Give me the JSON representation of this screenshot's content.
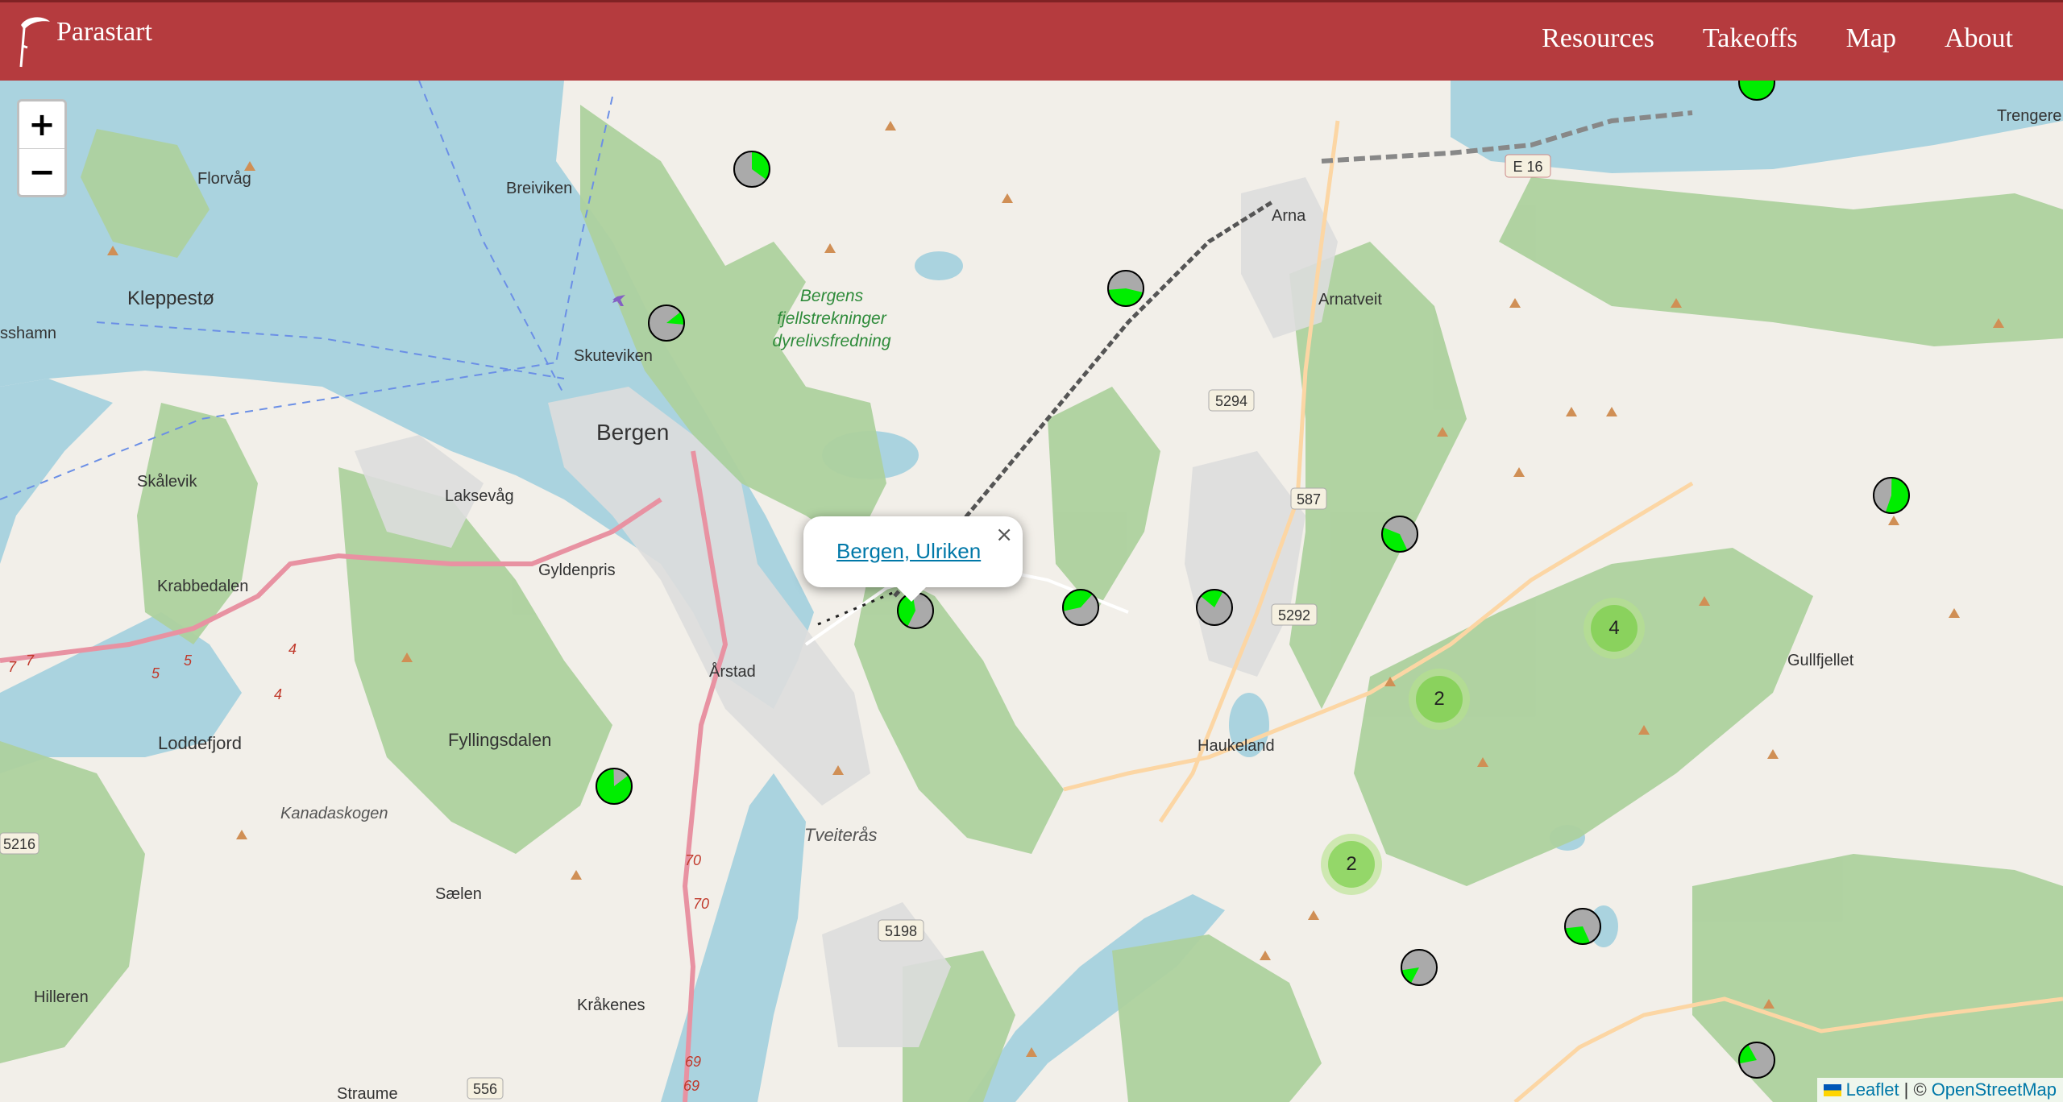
{
  "navbar": {
    "brand": "Parastart",
    "links": [
      "Resources",
      "Takeoffs",
      "Map",
      "About"
    ],
    "color": "#b53b3e"
  },
  "zoom": {
    "in": "+",
    "out": "−"
  },
  "popup": {
    "link": "Bergen, Ulriken",
    "close": "×"
  },
  "attribution": {
    "leaflet": "Leaflet",
    "separator": "| ©",
    "osm": "OpenStreetMap"
  },
  "map_labels": {
    "florvag": "Florvåg",
    "breiviken": "Breiviken",
    "kleppesto": "Kleppestø",
    "sshamn": "sshamn",
    "skuteviken": "Skuteviken",
    "bergen": "Bergen",
    "skalevik": "Skålevik",
    "laksevag": "Laksevåg",
    "krabbedalen": "Krabbedalen",
    "gyldenpris": "Gyldenpris",
    "arstad": "Årstad",
    "loddefjord": "Loddefjord",
    "fyllingsdalen": "Fyllingsdalen",
    "kanadaskogen": "Kanadaskogen",
    "tveiteras": "Tveiterås",
    "saelen": "Sælen",
    "hilleren": "Hilleren",
    "krakenes": "Kråkenes",
    "straume": "Straume",
    "arna": "Arna",
    "arnatveit": "Arnatveit",
    "haukeland": "Haukeland",
    "gullfjellet": "Gullfjellet",
    "trengereid": "Trengere",
    "reserve1": "Bergens",
    "reserve2": "fjellstrekninger",
    "reserve3": "dyrelivsfredning",
    "r5294": "5294",
    "r587": "587",
    "r5292": "5292",
    "r5198": "5198",
    "r5216": "5216",
    "r556": "556",
    "e16": "E 16",
    "r70a": "70",
    "r70b": "70",
    "r69a": "69",
    "r69b": "69",
    "r5a": "5",
    "r5b": "5",
    "r4a": "4",
    "r4b": "4",
    "r7a": "7",
    "r7b": "7"
  },
  "markers": {
    "colors": {
      "yes": "#00ee00",
      "no": "#aaaaaa"
    },
    "pies": [
      {
        "name": "marker-1",
        "good_fraction": 0.35
      },
      {
        "name": "marker-2",
        "good_fraction": 0.12
      },
      {
        "name": "marker-3",
        "good_fraction": 0.45
      },
      {
        "name": "marker-4",
        "good_fraction": 0.38
      },
      {
        "name": "marker-5-ulriken",
        "good_fraction": 0.4
      },
      {
        "name": "marker-6",
        "good_fraction": 0.4
      },
      {
        "name": "marker-7",
        "good_fraction": 0.22
      },
      {
        "name": "marker-8",
        "good_fraction": 0.55
      },
      {
        "name": "marker-9",
        "good_fraction": 0.85
      },
      {
        "name": "marker-10",
        "good_fraction": 1.0
      },
      {
        "name": "marker-11",
        "good_fraction": 0.3
      },
      {
        "name": "marker-12",
        "good_fraction": 0.15
      },
      {
        "name": "marker-13",
        "good_fraction": 0.2
      }
    ],
    "clusters": [
      {
        "name": "cluster-4",
        "count": "4"
      },
      {
        "name": "cluster-2a",
        "count": "2"
      },
      {
        "name": "cluster-2b",
        "count": "2"
      }
    ]
  }
}
